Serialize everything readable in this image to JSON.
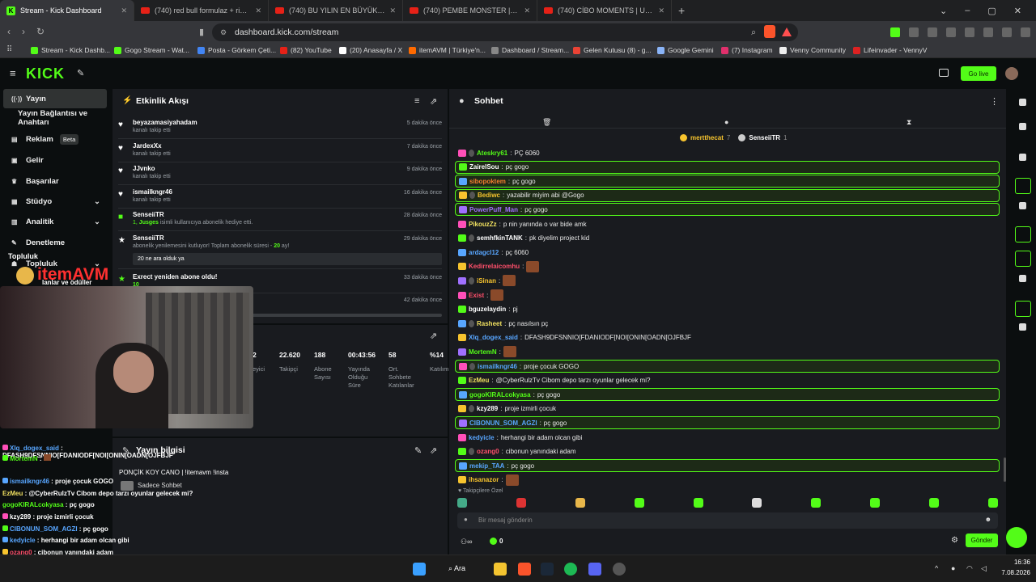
{
  "browser": {
    "tabs": [
      {
        "label": "Stream - Kick Dashboard",
        "icon": "kick-icon",
        "active": true
      },
      {
        "label": "(740) red bull formulaz + rize vlog -",
        "icon": "youtube-icon"
      },
      {
        "label": "(740) BU YILIN EN BÜYÜK DRAMASI",
        "icon": "youtube-icon"
      },
      {
        "label": "(740) PEMBE MONSTER | Madara Oi",
        "icon": "youtube-icon"
      },
      {
        "label": "(740) CİBO MOMENTS | ULTRA HIZL",
        "icon": "youtube-icon"
      }
    ],
    "url": "dashboard.kick.com/stream",
    "bookmarks": [
      "Stream - Kick Dashb...",
      "Gogo Stream - Wat...",
      "Posta - Görkem Çeti...",
      "(82) YouTube",
      "(20) Anasayfa / X",
      "itemAVM | Türkiye'n...",
      "Dashboard / Stream...",
      "Gelen Kutusu (8) - g...",
      "Google Gemini",
      "(7) Instagram",
      "Venny Community",
      "Lifeinvader - VennyV"
    ]
  },
  "header": {
    "logo": "KICK",
    "go_live": "Go live"
  },
  "sidebar": {
    "items": [
      {
        "label": "Yayın",
        "icon": "broadcast-icon",
        "active": true
      },
      {
        "label": "Yayın Bağlantısı ve Anahtarı",
        "icon": ""
      },
      {
        "label": "Reklam",
        "icon": "ad-icon",
        "badge": "Beta"
      },
      {
        "label": "Gelir",
        "icon": "money-icon"
      },
      {
        "label": "Başarılar",
        "icon": "trophy-icon"
      },
      {
        "label": "Stüdyo",
        "icon": "studio-icon"
      },
      {
        "label": "Analitik",
        "icon": "chart-icon"
      },
      {
        "label": "Denetleme",
        "icon": "wrench-icon"
      },
      {
        "label": "Topluluk",
        "icon": "community-icon"
      }
    ]
  },
  "activity": {
    "title": "Etkinlik Akışı",
    "events": [
      {
        "user": "beyazamasiyahadam",
        "text": "kanalı takip etti",
        "time": "5 dakika önce"
      },
      {
        "user": "JardexXx",
        "text": "kanalı takip etti",
        "time": "7 dakika önce"
      },
      {
        "user": "JJvnko",
        "text": "kanalı takip etti",
        "time": "9 dakika önce"
      },
      {
        "user": "ismailkngr46",
        "text": "kanalı takip etti",
        "time": "16 dakika önce"
      },
      {
        "user": "SenseiiTR",
        "text_pre": "1, ",
        "text_user": "Jusges",
        "text": " isimli kullanıcıya abonelik hediye etti.",
        "time": "28 dakika önce"
      },
      {
        "user": "SenseiiTR",
        "text": "abonelik yenilemesini kutluyor! Toplam abonelik süresi - ",
        "text_hl": "20",
        "text_post": " ay!",
        "message": "20 ne ara olduk ya",
        "time": "29 dakika önce"
      },
      {
        "user": "Exrect yeniden abone oldu!",
        "text_hl": "10",
        "text": " ",
        "time": "33 dakika önce"
      },
      {
        "user": "",
        "text": "üresi - ",
        "text_hl": "9",
        "text_post": " ay!",
        "time": "42 dakika önce"
      }
    ]
  },
  "stats": [
    {
      "value": "2",
      "label": "eyici"
    },
    {
      "value": "22.620",
      "label": "Takipçi"
    },
    {
      "value": "188",
      "label": "Abone Sayısı"
    },
    {
      "value": "00:43:56",
      "label": "Yayında Olduğu Süre"
    },
    {
      "value": "58",
      "label": "Ort. Sohbete Katılanlar"
    },
    {
      "value": "%14",
      "label": "Katılım"
    }
  ],
  "stream_info": {
    "title": "Yayın bilgisi",
    "stream_title": "PONÇİK KOY CANO | !itemavm !insta",
    "chat_mode": "Sadece Sohbet"
  },
  "chat": {
    "title": "Sohbet",
    "top_users": [
      {
        "name": "mertthecat",
        "count": "7"
      },
      {
        "name": "SenseiiTR",
        "count": "1"
      }
    ],
    "messages": [
      {
        "user": "Ateskry61",
        "text": "PÇ 6060",
        "color": "#53fc18",
        "hl": false
      },
      {
        "user": "ZairelSou",
        "text": "pç gogo",
        "color": "#ffffff",
        "hl": true
      },
      {
        "user": "sibopoktem",
        "text": "pç gogo",
        "color": "#f77f2e",
        "hl": true
      },
      {
        "user": "Bediwc",
        "text": "yazabilir miyim abi @Gogo",
        "color": "#f7c42e",
        "hl": true
      },
      {
        "user": "PowerPuff_Man",
        "text": "pç gogo",
        "color": "#a070ff",
        "hl": true
      },
      {
        "user": "PikouzZz",
        "text": "p nin yanında o var bide amk",
        "color": "#f0e060",
        "hl": false
      },
      {
        "user": "semhfkinTANK",
        "text": "pk diyelim project kid",
        "color": "#ffffff",
        "hl": false
      },
      {
        "user": "ardagcl12",
        "text": "pç 6060",
        "color": "#58a6ff",
        "hl": false
      },
      {
        "user": "Kedirrelaicomhu",
        "text": "",
        "color": "#ff4f6b",
        "hl": false,
        "emote": true
      },
      {
        "user": "iSinan",
        "text": "",
        "color": "#f7c42e",
        "hl": false,
        "emote": true
      },
      {
        "user": "Exist",
        "text": "",
        "color": "#ff4f6b",
        "hl": false,
        "emote": true
      },
      {
        "user": "bguzelaydin",
        "text": "pj",
        "color": "#ffffff",
        "hl": false
      },
      {
        "user": "Rasheet",
        "text": "pç nasılsın pç",
        "color": "#f0e060",
        "hl": false
      },
      {
        "user": "Xlq_dogex_said",
        "text": "DFASH9DFSNNIO[FDANIODF[NOI[ONIN[OADN[OJFBJF",
        "color": "#58a6ff",
        "hl": false
      },
      {
        "user": "MortemN",
        "text": "",
        "color": "#53fc18",
        "hl": false,
        "emote": true
      },
      {
        "user": "ismailkngr46",
        "text": "proje çocuk GOGO",
        "color": "#58a6ff",
        "hl": true
      },
      {
        "user": "EzMeu",
        "text": "@CyberRulzTv Cibom depo tarzı oyunlar gelecek mi?",
        "color": "#f0e060",
        "hl": false
      },
      {
        "user": "gogoKIRALcokyasa",
        "text": "pç gogo",
        "color": "#53fc18",
        "hl": true
      },
      {
        "user": "kzy289",
        "text": "proje izmirli çocuk",
        "color": "#ffffff",
        "hl": false
      },
      {
        "user": "CIBONUN_SOM_AGZI",
        "text": "pç gogo",
        "color": "#58a6ff",
        "hl": true
      },
      {
        "user": "kedyicle",
        "text": "herhangi bir adam olcan gibi",
        "color": "#58a6ff",
        "hl": false
      },
      {
        "user": "ozang0",
        "text": "cibonun yanındaki adam",
        "color": "#ff4f6b",
        "hl": false
      },
      {
        "user": "mekip_TAA",
        "text": "pç gogo",
        "color": "#58a6ff",
        "hl": true
      },
      {
        "user": "ihsanazor",
        "text": "",
        "color": "#f7c42e",
        "hl": false,
        "emote": true
      }
    ],
    "followers_only": "Takipçilere Özel",
    "input_placeholder": "Bir mesaj gönderin",
    "points": "0",
    "send_label": "Gönder"
  },
  "overlay": {
    "brand": "itemAVM",
    "sidebar_partial": "Topluluk",
    "sidebar_partial2": "lanlar ve ödüller",
    "chat": [
      {
        "user": "Xlq_dogex_said",
        "text": "DFASH9DFSNNIO[FDANIODF[NOI[ONIN[OADN[OJFBJF",
        "color": "#58a6ff"
      },
      {
        "user": "MortemN",
        "text": "",
        "color": "#53fc18"
      },
      {
        "user": "ismailkngr46",
        "text": "proje çocuk GOGO",
        "color": "#58a6ff"
      },
      {
        "user": "EzMeu",
        "text": "@CyberRulzTv Cibom depo tarzı oyunlar gelecek mi?",
        "color": "#f0e060"
      },
      {
        "user": "gogoKIRALcokyasa",
        "text": "pç gogo",
        "color": "#53fc18"
      },
      {
        "user": "kzy289",
        "text": "proje izmirli çocuk",
        "color": "#ffffff"
      },
      {
        "user": "CIBONUN_SOM_AGZI",
        "text": "pç gogo",
        "color": "#58a6ff"
      },
      {
        "user": "kedyicle",
        "text": "herhangi bir adam olcan gibi",
        "color": "#58a6ff"
      },
      {
        "user": "ozang0",
        "text": "cibonun yanındaki adam",
        "color": "#ff4f6b"
      },
      {
        "user": "mekip_TAA",
        "text": "pç gogo",
        "color": "#58a6ff"
      },
      {
        "user": "ihsanazor",
        "text": "",
        "color": "#f7c42e"
      }
    ]
  },
  "taskbar": {
    "search": "Ara",
    "time": "16:36",
    "date": "7.08.2026"
  },
  "colors": {
    "accent": "#53fc18",
    "panel": "#191b1f",
    "bg": "#0b0e0f"
  }
}
